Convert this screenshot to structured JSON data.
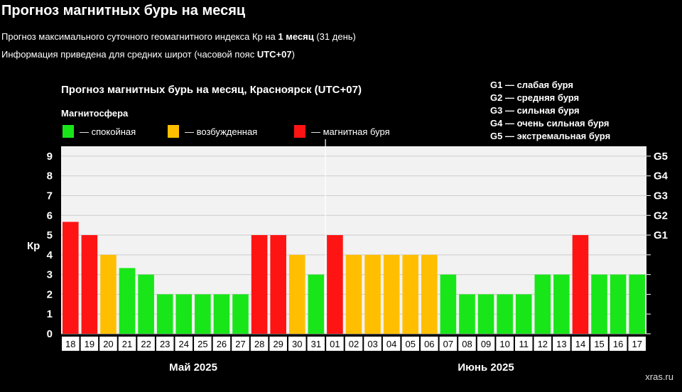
{
  "header": {
    "title": "Прогноз магнитных бурь на месяц",
    "line1_pre": "Прогноз максимального суточного геомагнитного индекса Кр на ",
    "line1_bold": "1 месяц",
    "line1_post": " (31 день)",
    "line2_pre": "Информация приведена для средних широт (часовой пояс ",
    "line2_bold": "UTC+07",
    "line2_post": ")"
  },
  "watermark": "xras.ru",
  "colors": {
    "calm": "#19e619",
    "excited": "#ffbf00",
    "storm": "#ff1414",
    "panel": "#f2f2f2",
    "grid": "#cccccc"
  },
  "chart_data": {
    "type": "bar",
    "title": "Прогноз магнитных бурь на месяц, Красноярск (UTC+07)",
    "legend_title": "Магнитосфера",
    "legend": [
      {
        "label": "— спокойная",
        "color": "#19e619"
      },
      {
        "label": "— возбужденная",
        "color": "#ffbf00"
      },
      {
        "label": "— магнитная буря",
        "color": "#ff1414"
      }
    ],
    "storm_scale": [
      "G1 — слабая буря",
      "G2 — средняя буря",
      "G3 — сильная буря",
      "G4 — очень сильная буря",
      "G5 — экстремальная буря"
    ],
    "ylabel": "Кр",
    "ylim": [
      0,
      9.5
    ],
    "yticks": [
      "0",
      "1",
      "2",
      "3",
      "4",
      "5",
      "6",
      "7",
      "8",
      "9"
    ],
    "g_ticks": [
      {
        "kp": 5,
        "label": "G1"
      },
      {
        "kp": 6,
        "label": "G2"
      },
      {
        "kp": 7,
        "label": "G3"
      },
      {
        "kp": 8,
        "label": "G4"
      },
      {
        "kp": 9,
        "label": "G5"
      }
    ],
    "months": [
      {
        "label": "Май 2025",
        "start": 0,
        "count": 14
      },
      {
        "label": "Июнь 2025",
        "start": 14,
        "count": 17
      }
    ],
    "categories": [
      "18",
      "19",
      "20",
      "21",
      "22",
      "23",
      "24",
      "25",
      "26",
      "27",
      "28",
      "29",
      "30",
      "31",
      "01",
      "02",
      "03",
      "04",
      "05",
      "06",
      "07",
      "08",
      "09",
      "10",
      "11",
      "12",
      "13",
      "14",
      "15",
      "16",
      "17"
    ],
    "values": [
      5.67,
      5,
      4,
      3.33,
      3,
      2,
      2,
      2,
      2,
      2,
      5,
      5,
      4,
      3,
      5,
      4,
      4,
      4,
      4,
      4,
      3,
      2,
      2,
      2,
      2,
      3,
      3,
      5,
      3,
      3,
      3
    ],
    "levels": [
      "storm",
      "storm",
      "excited",
      "calm",
      "calm",
      "calm",
      "calm",
      "calm",
      "calm",
      "calm",
      "storm",
      "storm",
      "excited",
      "calm",
      "storm",
      "excited",
      "excited",
      "excited",
      "excited",
      "excited",
      "calm",
      "calm",
      "calm",
      "calm",
      "calm",
      "calm",
      "calm",
      "storm",
      "calm",
      "calm",
      "calm"
    ]
  }
}
